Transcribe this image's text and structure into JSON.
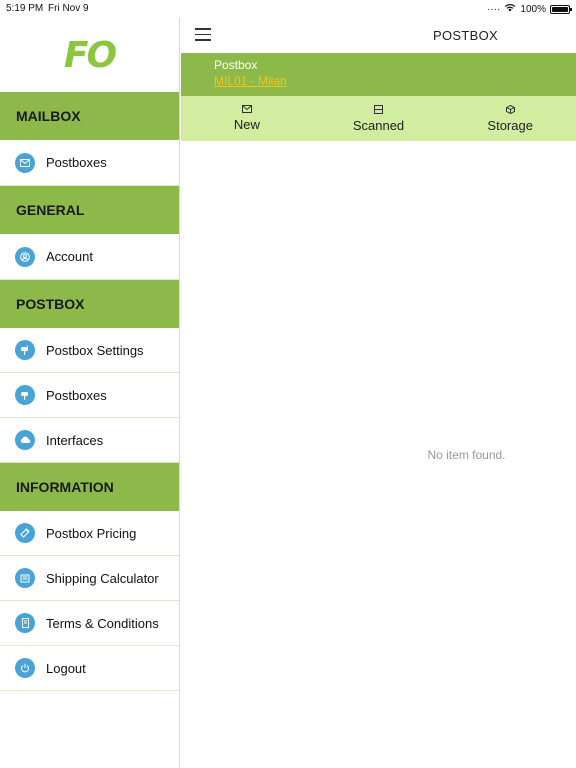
{
  "status": {
    "time": "5:19 PM",
    "date": "Fri Nov 9",
    "battery": "100%"
  },
  "logo": "FO",
  "sidebar": {
    "sections": [
      {
        "title": "MAILBOX",
        "items": [
          {
            "label": "Postboxes",
            "icon": "envelope-icon"
          }
        ]
      },
      {
        "title": "GENERAL",
        "items": [
          {
            "label": "Account",
            "icon": "user-icon"
          }
        ]
      },
      {
        "title": "POSTBOX",
        "items": [
          {
            "label": "Postbox Settings",
            "icon": "mailbox-icon"
          },
          {
            "label": "Postboxes",
            "icon": "mailbox-icon"
          },
          {
            "label": "Interfaces",
            "icon": "cloud-icon"
          }
        ]
      },
      {
        "title": "INFORMATION",
        "items": [
          {
            "label": "Postbox Pricing",
            "icon": "tag-icon"
          },
          {
            "label": "Shipping Calculator",
            "icon": "calculator-icon"
          },
          {
            "label": "Terms & Conditions",
            "icon": "document-icon"
          },
          {
            "label": "Logout",
            "icon": "power-icon"
          }
        ]
      }
    ]
  },
  "header": {
    "title": "POSTBOX"
  },
  "banner": {
    "label": "Postbox",
    "postbox": "MIL01 - Milan"
  },
  "tabs": [
    {
      "label": "New",
      "icon": "envelope-icon"
    },
    {
      "label": "Scanned",
      "icon": "scan-icon"
    },
    {
      "label": "Storage",
      "icon": "box-icon"
    }
  ],
  "empty_message": "No item found.",
  "colors": {
    "accent": "#8db94a",
    "tab_bar": "#d3eda0",
    "icon_circle": "#4aa3d6",
    "link": "#f5c518"
  }
}
